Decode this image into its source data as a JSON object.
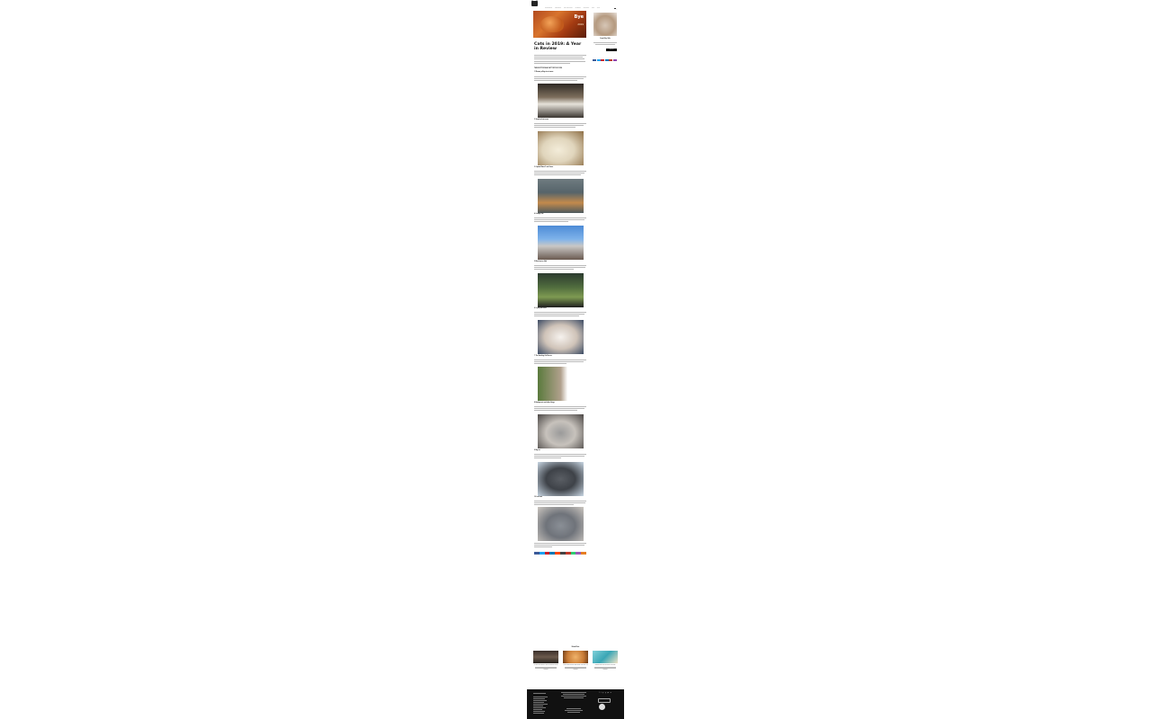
{
  "nav": {
    "items": [
      "Original Stories",
      "Cat Behavior",
      "Cat Health & Care",
      "Cat Breeds",
      "Cat Lifestyle",
      "Shop",
      "News"
    ]
  },
  "hero": {
    "overlay_title": "Bye",
    "overlay_year": "2019"
  },
  "article": {
    "title": "Cats in 2019: A Year in Review",
    "list_heading": "THE MOST POPULAR CAT TOPICS OF 2019",
    "sections": [
      {
        "heading": "1. Woman yelling at cat meme"
      },
      {
        "heading": "2. Surprised cat meme"
      },
      {
        "heading": "3. Captain Marvel's cat Goose"
      },
      {
        "heading": "4. Grumpy Cat"
      },
      {
        "heading": "5. Black cat on field"
      },
      {
        "heading": "6. Crying cat meme"
      },
      {
        "heading": "7. The Smirking Cat Rescue"
      },
      {
        "heading": "8. Bodega cats and other things"
      },
      {
        "heading": "9. Big cat"
      },
      {
        "heading": "10. Loaf cats"
      }
    ]
  },
  "sidebar": {
    "title": "Great Kitty Gifts",
    "button": "Shop Now",
    "badge": "Subscribe"
  },
  "related": {
    "heading": "Related Posts",
    "items": [
      {
        "title": "The best cat moments of 2019 and what they meant",
        "more": "Read More"
      },
      {
        "title": "10 Cat Trends Everyone Was Talking About This Year",
        "more": "Read More"
      },
      {
        "title": "What Does the New Year Hold for Your Cat?",
        "more": "Read More"
      }
    ]
  },
  "colors": {
    "share": [
      "#3b5998",
      "#1da1f2",
      "#cb2027",
      "#0077b5",
      "#ff4500",
      "#444444",
      "#c0392b",
      "#2ecc71",
      "#9b59b6",
      "#e67e22"
    ],
    "social": [
      "#3b5998",
      "#1da1f2",
      "#cb2027",
      "#0077b5",
      "#c0392b",
      "#8e44ad"
    ]
  }
}
